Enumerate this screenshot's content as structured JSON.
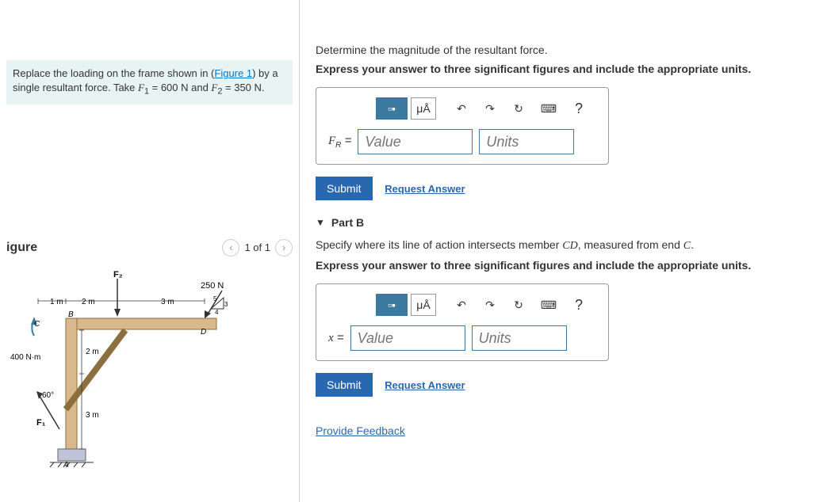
{
  "problem": {
    "text_pre": "Replace the loading on the frame shown in (",
    "figure_link": "Figure 1",
    "text_post": ") by a single resultant force. Take ",
    "f1_var": "F",
    "f1_sub": "1",
    "f1_val": " = 600 N and ",
    "f2_var": "F",
    "f2_sub": "2",
    "f2_val": " = 350 N."
  },
  "figure": {
    "title": "igure",
    "pager": "1 of 1"
  },
  "figure_labels": {
    "f2": "F₂",
    "load250": "250 N",
    "d1m": "1 m",
    "d2m": "2 m",
    "d3m": "3 m",
    "d2m_v": "2 m",
    "d3m_v": "3 m",
    "moment": "400 N·m",
    "angle": "60°",
    "f1": "F₁",
    "pA": "A",
    "pB": "B",
    "pC": "C",
    "pD": "D",
    "tri5": "5",
    "tri3": "3",
    "tri4": "4"
  },
  "partA": {
    "q": "Determine the magnitude of the resultant force.",
    "instr": "Express your answer to three significant figures and include the appropriate units.",
    "var": "F",
    "sub": "R",
    "eq": " = ",
    "value_ph": "Value",
    "units_ph": "Units"
  },
  "partB": {
    "title": "Part B",
    "q_pre": "Specify where its line of action intersects member ",
    "q_cd": "CD",
    "q_mid": ", measured from end ",
    "q_c": "C",
    "q_post": ".",
    "instr": "Express your answer to three significant figures and include the appropriate units.",
    "var": "x",
    "eq": " = ",
    "value_ph": "Value",
    "units_ph": "Units"
  },
  "tools": {
    "templates": "▫▪",
    "units": "μÅ",
    "undo": "↶",
    "redo": "↷",
    "reset": "↻",
    "keyboard": "⌨",
    "help": "?"
  },
  "buttons": {
    "submit": "Submit",
    "request": "Request Answer",
    "feedback": "Provide Feedback"
  }
}
